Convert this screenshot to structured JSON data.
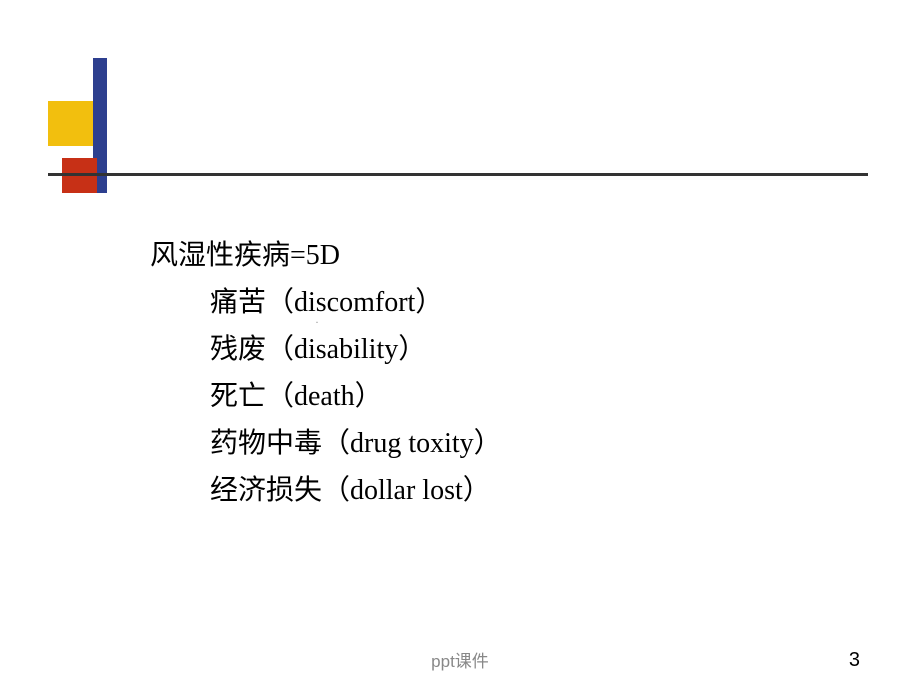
{
  "content": {
    "title": "风湿性疾病=5D",
    "items": [
      "痛苦（discomfort）",
      "残废（disability）",
      "死亡（death）",
      "药物中毒（drug  toxity）",
      "经济损失（dollar  lost）"
    ]
  },
  "footer": {
    "label": "ppt课件",
    "pageNumber": "3"
  },
  "centerMark": "·"
}
